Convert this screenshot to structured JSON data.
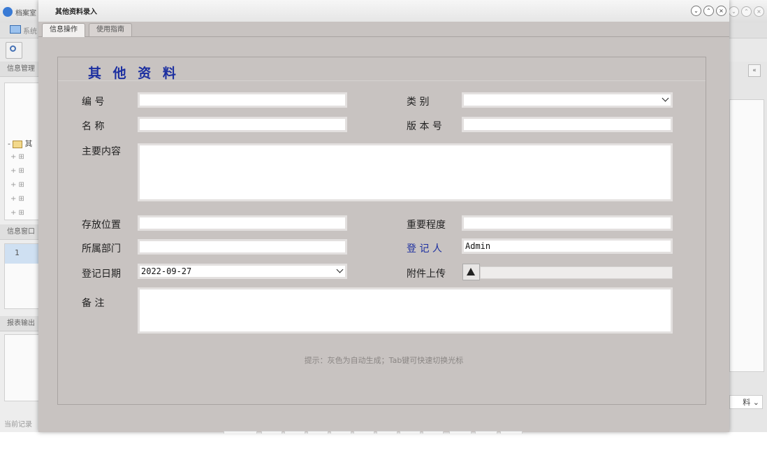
{
  "background_app": {
    "title": "档案室",
    "menu_label": "系统",
    "panel_info_manage": "信息管理",
    "tree_folder_label": "其",
    "panel_info_window": "信息窗口",
    "info_row_index": "1",
    "panel_report": "报表输出",
    "status_text": "当前记录",
    "right_select_value": "料"
  },
  "dialog": {
    "title": "其他资料录入",
    "tabs": [
      {
        "label": "信息操作",
        "active": true
      },
      {
        "label": "使用指南",
        "active": false
      }
    ],
    "form": {
      "heading": "其 他 资 料",
      "fields": {
        "number": {
          "label": "编 号",
          "value": ""
        },
        "category": {
          "label": "类 别",
          "value": ""
        },
        "name": {
          "label": "名 称",
          "value": ""
        },
        "version": {
          "label": "版 本 号",
          "value": ""
        },
        "content": {
          "label": "主要内容",
          "value": ""
        },
        "location": {
          "label": "存放位置",
          "value": ""
        },
        "importance": {
          "label": "重要程度",
          "value": ""
        },
        "department": {
          "label": "所属部门",
          "value": ""
        },
        "registrar": {
          "label": "登 记 人",
          "value": "Admin"
        },
        "reg_date": {
          "label": "登记日期",
          "value": "2022-09-27"
        },
        "attachment": {
          "label": "附件上传",
          "value": ""
        },
        "remarks": {
          "label": "备 注",
          "value": ""
        }
      },
      "hint": "提示：灰色为自动生成；Tab键可快速切换光标"
    }
  },
  "colors": {
    "dialog_bg": "#c8c3c1",
    "heading_blue": "#1c2fa0",
    "input_border": "#e3e0df"
  },
  "icons": [
    "logo-icon",
    "search-icon",
    "folder-icon",
    "minimize-icon",
    "maximize-icon",
    "close-icon",
    "upload-icon",
    "chevron-down-icon",
    "collapse-icon"
  ]
}
